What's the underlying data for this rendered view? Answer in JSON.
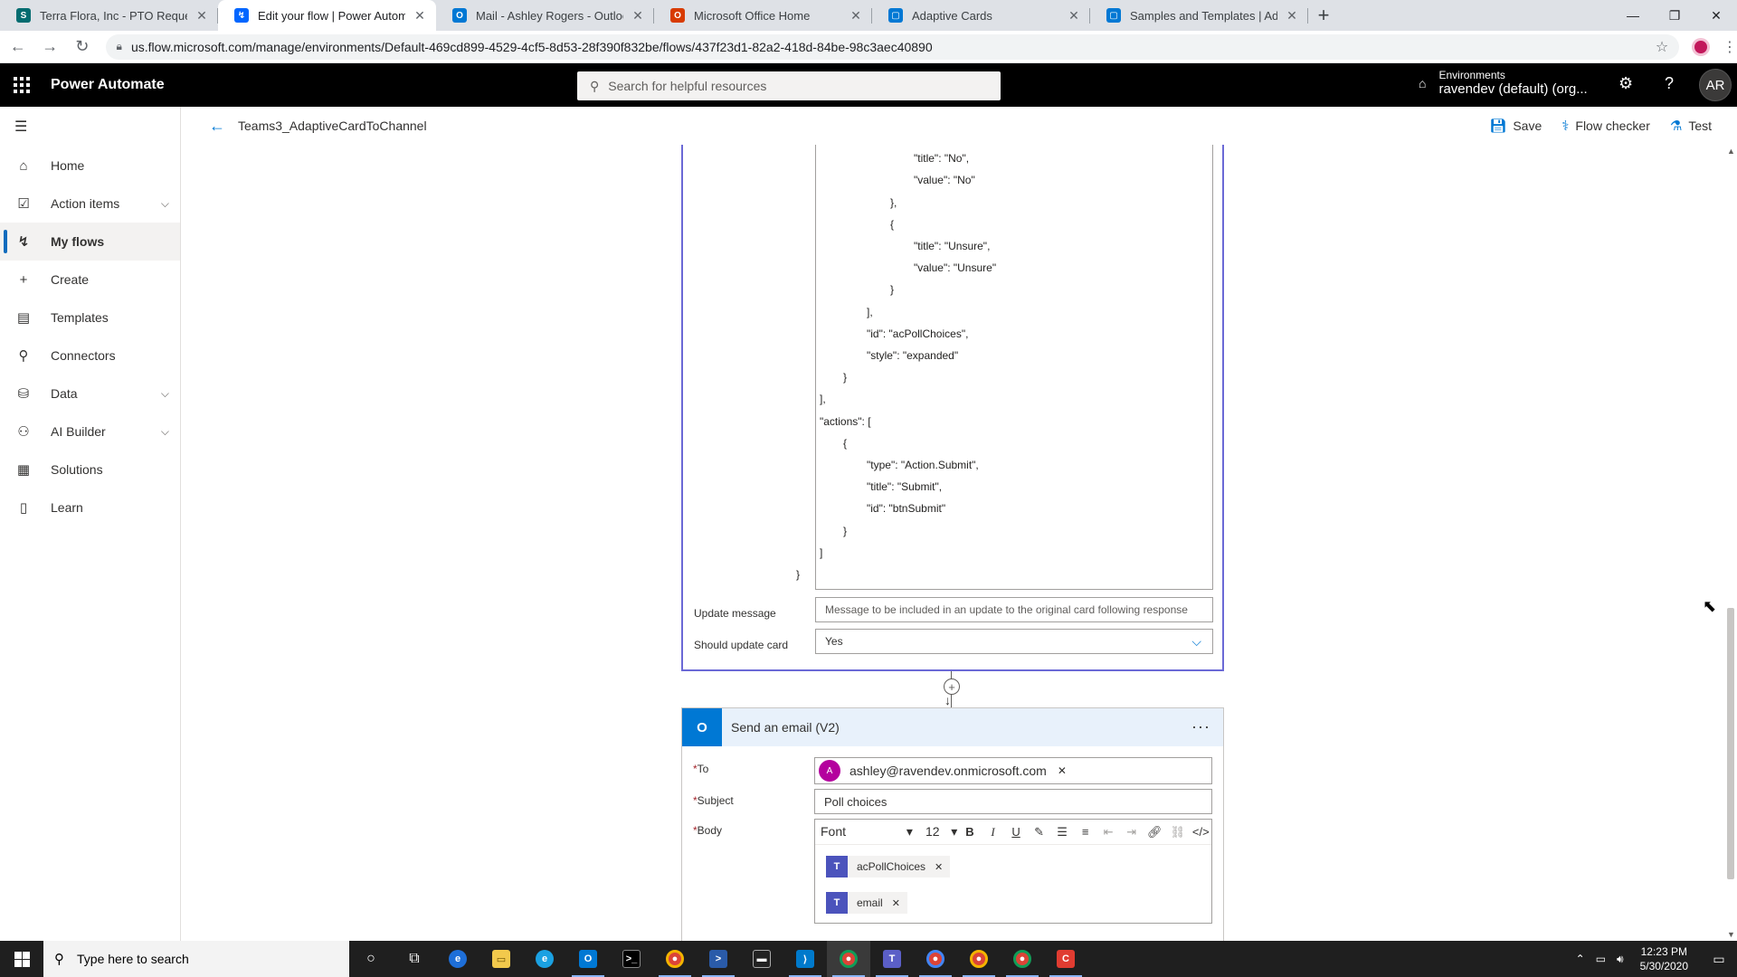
{
  "browser": {
    "tabs": [
      {
        "title": "Terra Flora, Inc - PTO Requests -",
        "favicon": "S",
        "favicon_color": "#036c70",
        "active": false
      },
      {
        "title": "Edit your flow | Power Automate",
        "favicon": "↯",
        "favicon_color": "#0066ff",
        "active": true
      },
      {
        "title": "Mail - Ashley Rogers - Outlook",
        "favicon": "O",
        "favicon_color": "#0078d4",
        "active": false
      },
      {
        "title": "Microsoft Office Home",
        "favicon": "O",
        "favicon_color": "#d83b01",
        "active": false
      },
      {
        "title": "Adaptive Cards",
        "favicon": "▢",
        "favicon_color": "#0078d4",
        "active": false
      },
      {
        "title": "Samples and Templates | Adaptiv",
        "favicon": "▢",
        "favicon_color": "#0078d4",
        "active": false
      }
    ],
    "url": "us.flow.microsoft.com/manage/environments/Default-469cd899-4529-4cf5-8d53-28f390f832be/flows/437f23d1-82a2-418d-84be-98c3aec40890"
  },
  "app": {
    "title": "Power Automate",
    "search_placeholder": "Search for helpful resources",
    "env_label": "Environments",
    "env_name": "ravendev (default) (org...",
    "avatar_initials": "AR"
  },
  "nav": {
    "items": [
      {
        "label": "Home",
        "icon": "⌂",
        "chevron": false,
        "active": false
      },
      {
        "label": "Action items",
        "icon": "☑",
        "chevron": true,
        "active": false
      },
      {
        "label": "My flows",
        "icon": "↯",
        "chevron": false,
        "active": true
      },
      {
        "label": "Create",
        "icon": "+",
        "chevron": false,
        "active": false
      },
      {
        "label": "Templates",
        "icon": "▤",
        "chevron": false,
        "active": false
      },
      {
        "label": "Connectors",
        "icon": "⚲",
        "chevron": false,
        "active": false
      },
      {
        "label": "Data",
        "icon": "⛁",
        "chevron": true,
        "active": false
      },
      {
        "label": "AI Builder",
        "icon": "⚇",
        "chevron": true,
        "active": false
      },
      {
        "label": "Solutions",
        "icon": "▦",
        "chevron": false,
        "active": false
      },
      {
        "label": "Learn",
        "icon": "▯",
        "chevron": false,
        "active": false
      }
    ]
  },
  "command_bar": {
    "flow_name": "Teams3_AdaptiveCardToChannel",
    "save": "Save",
    "flow_checker": "Flow checker",
    "test": "Test"
  },
  "card1": {
    "json_lines": [
      {
        "text": "{",
        "indent": 2
      },
      {
        "text": "\"title\": \"No\",",
        "indent": 3
      },
      {
        "text": "\"value\": \"No\"",
        "indent": 3
      },
      {
        "text": "},",
        "indent": 2
      },
      {
        "text": "{",
        "indent": 2
      },
      {
        "text": "\"title\": \"Unsure\",",
        "indent": 3
      },
      {
        "text": "\"value\": \"Unsure\"",
        "indent": 3
      },
      {
        "text": "}",
        "indent": 2
      },
      {
        "text": "],",
        "indent": 1
      },
      {
        "text": "\"id\": \"acPollChoices\",",
        "indent": 1
      },
      {
        "text": "\"style\": \"expanded\"",
        "indent": 1
      },
      {
        "text": "}",
        "indent": 0
      },
      {
        "text": "],",
        "indent": -1
      },
      {
        "text": "\"actions\": [",
        "indent": -1
      },
      {
        "text": "{",
        "indent": 0
      },
      {
        "text": "\"type\": \"Action.Submit\",",
        "indent": 1
      },
      {
        "text": "\"title\": \"Submit\",",
        "indent": 1
      },
      {
        "text": "\"id\": \"btnSubmit\"",
        "indent": 1
      },
      {
        "text": "}",
        "indent": 0
      },
      {
        "text": "]",
        "indent": -1
      },
      {
        "text": "}",
        "indent": -2
      }
    ],
    "update_message_label": "Update message",
    "update_message_placeholder": "Message to be included in an update to the original card following response",
    "should_update_label": "Should update card",
    "should_update_value": "Yes"
  },
  "card2": {
    "title": "Send an email (V2)",
    "to_label": "To",
    "to_chip_initial": "A",
    "to_value": "ashley@ravendev.onmicrosoft.com",
    "subject_label": "Subject",
    "subject_value": "Poll choices",
    "body_label": "Body",
    "font_label": "Font",
    "font_size": "12",
    "tokens": [
      "acPollChoices",
      "email"
    ]
  },
  "taskbar": {
    "search_placeholder": "Type here to search",
    "time": "12:23 PM",
    "date": "5/30/2020"
  }
}
